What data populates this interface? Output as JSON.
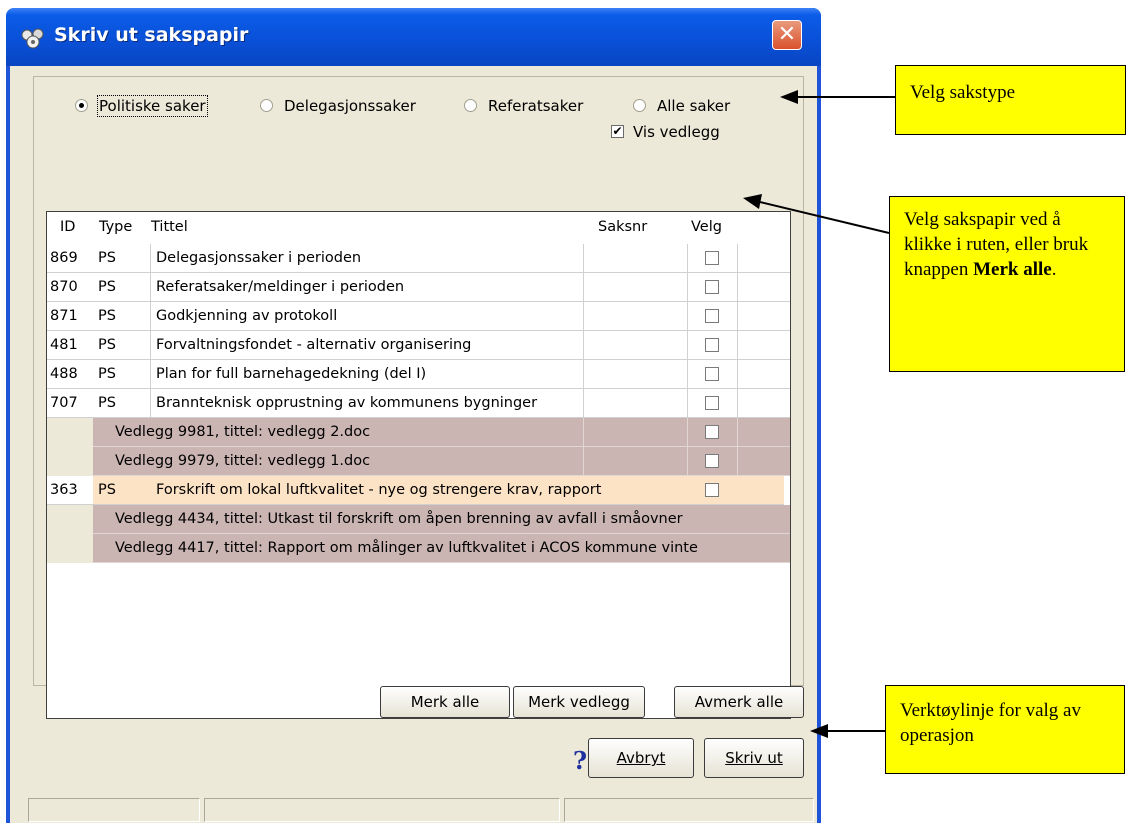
{
  "window": {
    "title": "Skriv ut sakspapir",
    "close_glyph": "✕"
  },
  "filters": {
    "radios": [
      {
        "label": "Politiske saker",
        "selected": true
      },
      {
        "label": "Delegasjonssaker",
        "selected": false
      },
      {
        "label": "Referatsaker",
        "selected": false
      },
      {
        "label": "Alle saker",
        "selected": false
      }
    ],
    "show_attachments": {
      "label": "Vis vedlegg",
      "checked": true,
      "mark": "✔"
    }
  },
  "grid": {
    "columns": {
      "id": "ID",
      "type": "Type",
      "title": "Tittel",
      "caseno": "Saksnr",
      "select": "Velg"
    },
    "rows": [
      {
        "id": "869",
        "type": "PS",
        "title": "Delegasjonssaker i perioden"
      },
      {
        "id": "870",
        "type": "PS",
        "title": "Referatsaker/meldinger i perioden"
      },
      {
        "id": "871",
        "type": "PS",
        "title": "Godkjenning av protokoll"
      },
      {
        "id": "481",
        "type": "PS",
        "title": "Forvaltningsfondet - alternativ organisering"
      },
      {
        "id": "488",
        "type": "PS",
        "title": "Plan for full barnehagedekning (del I)"
      },
      {
        "id": "707",
        "type": "PS",
        "title": "Brannteknisk opprustning av kommunens bygninger"
      },
      {
        "attachment": "Vedlegg 9981, tittel: vedlegg 2.doc"
      },
      {
        "attachment": "Vedlegg 9979, tittel: vedlegg 1.doc"
      },
      {
        "id": "363",
        "type": "PS",
        "title": "Forskrift om lokal luftkvalitet - nye og strengere krav, rapport"
      },
      {
        "attachment": "Vedlegg 4434, tittel: Utkast til forskrift om åpen brenning av avfall i småovner"
      },
      {
        "attachment": "Vedlegg 4417, tittel: Rapport om målinger av luftkvalitet i ACOS kommune vinte"
      }
    ]
  },
  "toolbar": {
    "mark_all": "Merk alle",
    "mark_attachments": "Merk vedlegg",
    "unmark_all": "Avmerk alle",
    "help_glyph": "?",
    "cancel": "Avbryt",
    "print": "Skriv ut"
  },
  "annotations": {
    "select_type": "Velg sakstype",
    "select_papers_parts": [
      "Velg sakspapir ved å klikke i ruten, eller bruk knappen ",
      "Merk alle",
      "."
    ],
    "toolbar_note": "Verktøylinje for valg av operasjon"
  },
  "colors": {
    "title_bar": "#0a4fd6",
    "dialog_bg": "#ece9d8",
    "attachment_row": "#cbb5b3",
    "highlight_row": "#fde3c6",
    "note_bg": "#ffff00"
  }
}
